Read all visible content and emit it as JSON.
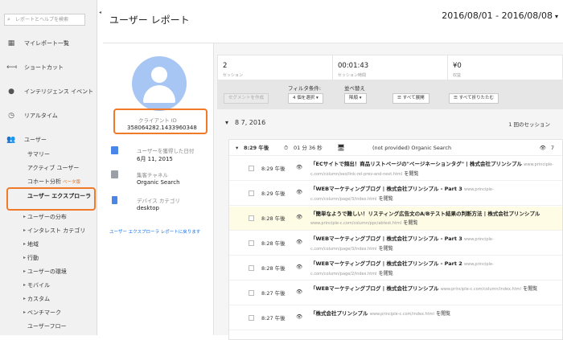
{
  "sidebar": {
    "search_placeholder": "レポートとヘルプを検索",
    "items": [
      {
        "label": "マイレポート一覧",
        "icon": "grid-icon"
      },
      {
        "label": "ショートカット",
        "icon": "shortcut-arrow-icon"
      },
      {
        "label": "インテリジェンス イベント",
        "icon": "lightbulb-icon"
      },
      {
        "label": "リアルタイム",
        "icon": "clock-icon"
      },
      {
        "label": "ユーザー",
        "icon": "users-icon"
      }
    ],
    "sub_items": [
      "サマリー",
      "アクティブ ユーザー",
      "コホート分析",
      "ユーザー エクスプローラ",
      "ユーザーの分布",
      "インタレスト カテゴリ",
      "地域",
      "行動",
      "ユーザーの環境",
      "モバイル",
      "カスタム",
      "ベンチマーク",
      "ユーザーフロー"
    ],
    "beta_label": "ベータ版"
  },
  "header": {
    "title": "ユーザー レポート",
    "date_range": "2016/08/01 - 2016/08/08"
  },
  "profile": {
    "client_id_label": "クライアント ID",
    "client_id": "358064282.1433960348",
    "acquired_label": "ユーザーを獲得した日付",
    "acquired_value": "6月 11, 2015",
    "channel_label": "集客チャネル",
    "channel_value": "Organic Search",
    "device_label": "デバイス カテゴリ",
    "device_value": "desktop",
    "back_link": "ユーザー エクスプローラ レポートに戻ります"
  },
  "metrics": [
    {
      "value": "2",
      "label": "セッション"
    },
    {
      "value": "00:01:43",
      "label": "セッション時間"
    },
    {
      "value": "¥0",
      "label": "収益"
    }
  ],
  "filter": {
    "segment_button": "セグメントを作成",
    "filter_label": "フィルタ条件:",
    "filter_value": "4 個を選択",
    "sort_label": "並べ替え",
    "sort_value": "降順",
    "expand_all": "すべて展開",
    "collapse_all": "すべて折りたたむ"
  },
  "date_group": {
    "date": "8 7, 2016",
    "session_count": "1 回のセッション"
  },
  "session": {
    "time": "8:29 午後",
    "duration": "01 分 36 秒",
    "source": "(not provided) Organic Search",
    "hits": "7"
  },
  "hits": [
    {
      "time": "8:29 午後",
      "title": "「ECサイトで頻出！商品リストページの\"ページネーションタグ\" | 株式会社プリンシプル",
      "url": "www.principle-c.com/column/seo/link-rel-prev-and-next.html",
      "action": "を閲覧",
      "highlight": false
    },
    {
      "time": "8:29 午後",
      "title": "「WEBマーケティングブログ | 株式会社プリンシプル - Part 3",
      "url": "www.principle-c.com/column/page/3/index.html",
      "action": "を閲覧",
      "highlight": false
    },
    {
      "time": "8:28 午後",
      "title": "「簡単なようで難しい！リスティング広告文のA/Bテスト結果の判断方法 | 株式会社プリンシプル",
      "url": "www.principle-c.com/column/ppc/abtest.html",
      "action": "を閲覧",
      "highlight": true
    },
    {
      "time": "8:28 午後",
      "title": "「WEBマーケティングブログ | 株式会社プリンシプル - Part 3",
      "url": "www.principle-c.com/column/page/3/index.html",
      "action": "を閲覧",
      "highlight": false
    },
    {
      "time": "8:28 午後",
      "title": "「WEBマーケティングブログ | 株式会社プリンシプル - Part 2",
      "url": "www.principle-c.com/column/page/2/index.html",
      "action": "を閲覧",
      "highlight": false
    },
    {
      "time": "8:27 午後",
      "title": "「WEBマーケティングブログ | 株式会社プリンシプル",
      "url": "www.principle-c.com/column/index.html",
      "action": "を閲覧",
      "highlight": false
    },
    {
      "time": "8:27 午後",
      "title": "「株式会社プリンシプル",
      "url": "www.principle-c.com/index.html",
      "action": "を閲覧",
      "highlight": false
    }
  ]
}
